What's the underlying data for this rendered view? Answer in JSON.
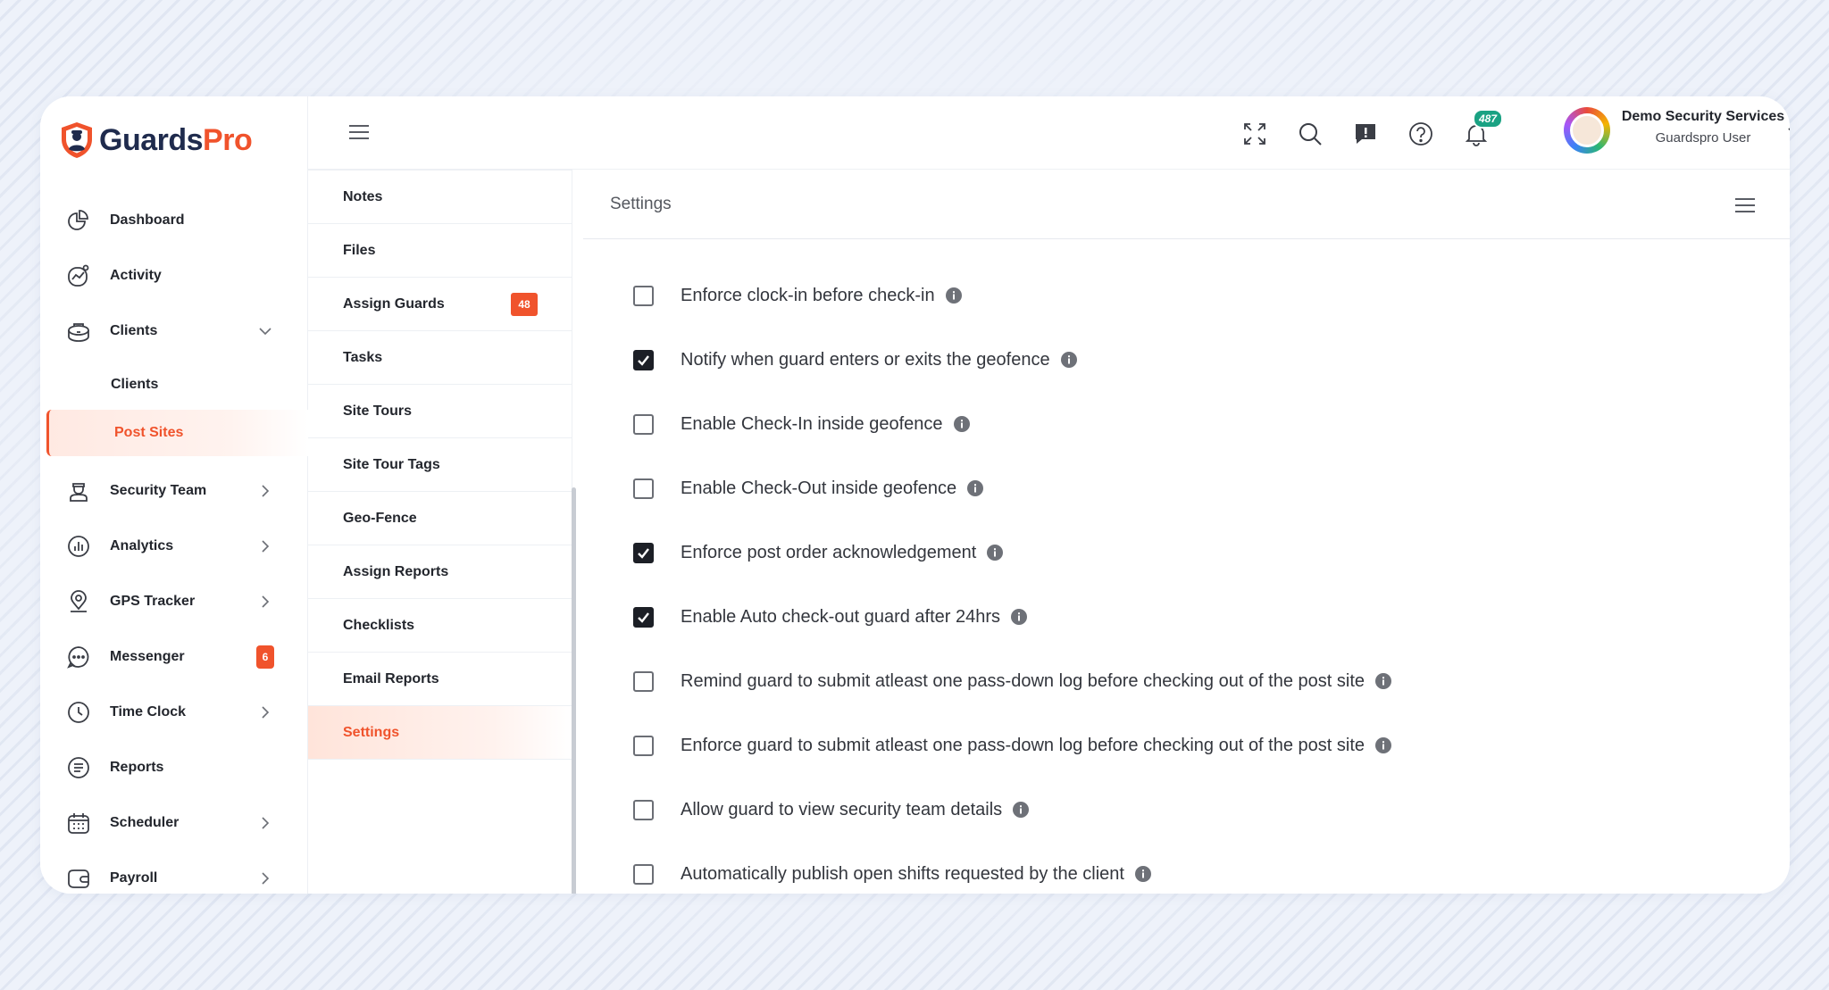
{
  "brand": {
    "name_part1": "Guards",
    "name_part2": "Pro",
    "accent": "#f0532c",
    "dark": "#1f2b4d"
  },
  "sidebar": {
    "items": [
      {
        "label": "Dashboard",
        "icon": "pie-chart-icon"
      },
      {
        "label": "Activity",
        "icon": "activity-icon"
      },
      {
        "label": "Clients",
        "icon": "clients-icon",
        "expanded": true
      },
      {
        "label": "Security Team",
        "icon": "guard-icon"
      },
      {
        "label": "Analytics",
        "icon": "analytics-icon"
      },
      {
        "label": "GPS Tracker",
        "icon": "location-pin-icon"
      },
      {
        "label": "Messenger",
        "icon": "chat-icon",
        "badge": "6"
      },
      {
        "label": "Time Clock",
        "icon": "clock-icon"
      },
      {
        "label": "Reports",
        "icon": "reports-icon"
      },
      {
        "label": "Scheduler",
        "icon": "calendar-icon"
      },
      {
        "label": "Payroll",
        "icon": "wallet-icon"
      }
    ],
    "sub_items": [
      {
        "label": "Clients"
      },
      {
        "label": "Post Sites",
        "active": true
      }
    ]
  },
  "topbar": {
    "notification_count": "487",
    "user_company": "Demo Security Services",
    "user_role": "Guardspro User"
  },
  "subpanel": {
    "items": [
      {
        "label": "Notes"
      },
      {
        "label": "Files"
      },
      {
        "label": "Assign Guards",
        "badge": "48"
      },
      {
        "label": "Tasks"
      },
      {
        "label": "Site Tours"
      },
      {
        "label": "Site Tour Tags"
      },
      {
        "label": "Geo-Fence"
      },
      {
        "label": "Assign Reports"
      },
      {
        "label": "Checklists"
      },
      {
        "label": "Email Reports"
      },
      {
        "label": "Settings",
        "active": true
      }
    ]
  },
  "main": {
    "title": "Settings",
    "settings": [
      {
        "label": "Enforce clock-in before check-in",
        "checked": false
      },
      {
        "label": "Notify when guard enters or exits the geofence",
        "checked": true
      },
      {
        "label": "Enable Check-In inside geofence",
        "checked": false
      },
      {
        "label": "Enable Check-Out inside geofence",
        "checked": false
      },
      {
        "label": "Enforce post order acknowledgement",
        "checked": true
      },
      {
        "label": "Enable Auto check-out guard after 24hrs",
        "checked": true
      },
      {
        "label": "Remind guard to submit atleast one pass-down log before checking out of the post site",
        "checked": false
      },
      {
        "label": "Enforce guard to submit atleast one pass-down log before checking out of the post site",
        "checked": false
      },
      {
        "label": "Allow guard to view security team details",
        "checked": false
      },
      {
        "label": "Automatically publish open shifts requested by the client",
        "checked": false
      }
    ]
  }
}
